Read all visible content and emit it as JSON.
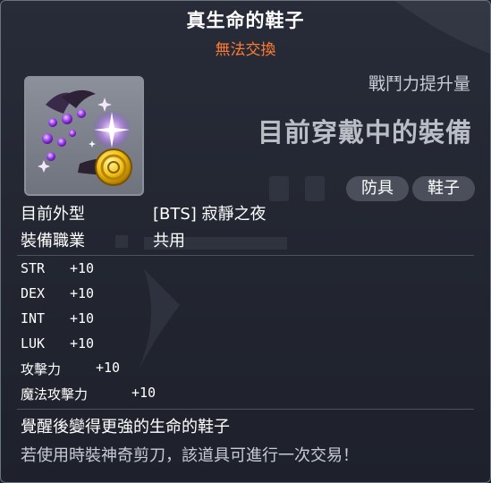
{
  "item": {
    "title": "真生命的鞋子",
    "trade_status": "無法交換",
    "combat_power_label": "戰鬥力提升量",
    "equipped_label": "目前穿戴中的裝備",
    "tags": [
      "防具",
      "鞋子"
    ],
    "icon": "dark-purple-shoes-with-gold-coin-icon"
  },
  "details": {
    "appearance_label": "目前外型",
    "appearance_value": "[BTS] 寂靜之夜",
    "job_label": "裝備職業",
    "job_value": "共用"
  },
  "stats": [
    {
      "name": "STR",
      "value": "+10"
    },
    {
      "name": "DEX",
      "value": "+10"
    },
    {
      "name": "INT",
      "value": "+10"
    },
    {
      "name": "LUK",
      "value": "+10"
    },
    {
      "name": "攻擊力",
      "value": "+10"
    },
    {
      "name": "魔法攻擊力",
      "value": "+10"
    }
  ],
  "description": {
    "line1": "覺醒後變得更強的生命的鞋子",
    "line2": "若使用時裝神奇剪刀，該道具可進行一次交易！"
  },
  "colors": {
    "trade_status": "#ff7b33",
    "background": "#282c38",
    "tag_bg": "#4a4f5b"
  }
}
